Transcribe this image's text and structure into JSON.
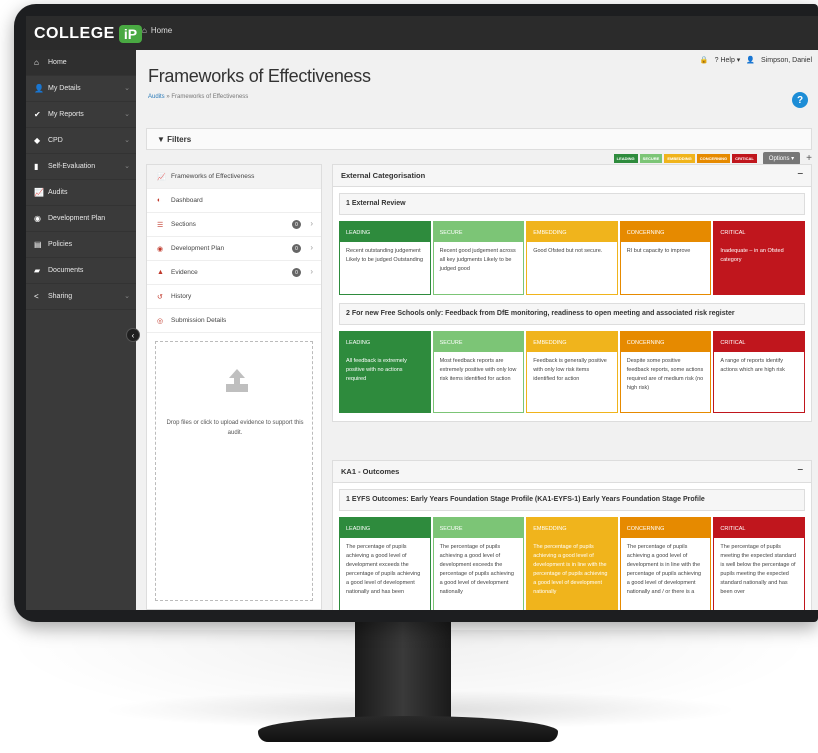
{
  "brand": {
    "name": "COLLEGE",
    "badge": "iP"
  },
  "topbar": {
    "home": "Home",
    "help": "Help",
    "user": "Simpson, Daniel"
  },
  "sidebar": {
    "items": [
      {
        "label": "Home",
        "icon": "home-icon"
      },
      {
        "label": "My Details",
        "icon": "user-icon"
      },
      {
        "label": "My Reports",
        "icon": "check-icon"
      },
      {
        "label": "CPD",
        "icon": "bolt-icon"
      },
      {
        "label": "Self-Evaluation",
        "icon": "book-icon"
      },
      {
        "label": "Audits",
        "icon": "chart-icon"
      },
      {
        "label": "Development Plan",
        "icon": "target-icon"
      },
      {
        "label": "Policies",
        "icon": "file-icon"
      },
      {
        "label": "Documents",
        "icon": "folder-icon"
      },
      {
        "label": "Sharing",
        "icon": "share-icon"
      }
    ]
  },
  "page": {
    "title": "Frameworks of Effectiveness",
    "breadcrumb_link": "Audits",
    "breadcrumb_current": "» Frameworks of Effectiveness",
    "help": "?"
  },
  "filters": {
    "label": "Filters",
    "options": "Options ▾",
    "plus": "+"
  },
  "legend": [
    {
      "label": "LEADING",
      "color": "#2e8b3d"
    },
    {
      "label": "SECURE",
      "color": "#7cc576"
    },
    {
      "label": "EMBEDDING",
      "color": "#f0b41c"
    },
    {
      "label": "CONCERNING",
      "color": "#e68a00"
    },
    {
      "label": "CRITICAL",
      "color": "#c0161d"
    }
  ],
  "leftnav": {
    "items": [
      {
        "label": "Frameworks of Effectiveness",
        "icon": "chart-icon"
      },
      {
        "label": "Dashboard",
        "icon": "dashboard-icon"
      },
      {
        "label": "Sections",
        "icon": "list-icon",
        "badge": "0"
      },
      {
        "label": "Development Plan",
        "icon": "target-icon",
        "badge": "0"
      },
      {
        "label": "Evidence",
        "icon": "warning-icon",
        "badge": "0"
      },
      {
        "label": "History",
        "icon": "history-icon"
      },
      {
        "label": "Submission Details",
        "icon": "record-icon"
      }
    ],
    "drop_text": "Drop files or click to upload evidence to support this audit."
  },
  "sections": [
    {
      "title": "External Categorisation",
      "subsections": [
        {
          "title": "1 External Review",
          "cards": [
            {
              "level": "LEADING",
              "text": "Recent outstanding judgement Likely to be judged Outstanding"
            },
            {
              "level": "SECURE",
              "text": "Recent good judgement across all key judgments Likely to be judged good"
            },
            {
              "level": "EMBEDDING",
              "text": "Good Ofsted but not secure."
            },
            {
              "level": "CONCERNING",
              "text": "RI but capacity to improve"
            },
            {
              "level": "CRITICAL",
              "text": "Inadequate – in an Ofsted category"
            }
          ]
        },
        {
          "title": "2 For new Free Schools only: Feedback from DfE monitoring, readiness to open meeting and associated risk register",
          "cards": [
            {
              "level": "LEADING",
              "text": "All feedback is extremely positive with no actions required"
            },
            {
              "level": "SECURE",
              "text": "Most feedback reports are extremely positive with only low risk items identified for action"
            },
            {
              "level": "EMBEDDING",
              "text": "Feedback is generally positive with only low risk items identified for action"
            },
            {
              "level": "CONCERNING",
              "text": "Despite some positive feedback reports, some actions required are of medium risk (no high risk)"
            },
            {
              "level": "CRITICAL",
              "text": "A range of reports identify actions which are high risk"
            }
          ]
        }
      ]
    },
    {
      "title": "KA1 - Outcomes",
      "subsections": [
        {
          "title": "1 EYFS Outcomes: Early Years Foundation Stage Profile (KA1-EYFS-1) Early Years Foundation Stage Profile",
          "cards": [
            {
              "level": "LEADING",
              "text": "The percentage of pupils achieving a good level of development exceeds the percentage of pupils achieving a good level of development nationally and has been"
            },
            {
              "level": "SECURE",
              "text": "The percentage of pupils achieving a good level of development exceeds the percentage of pupils achieving a good level of development nationally"
            },
            {
              "level": "EMBEDDING",
              "text": "The percentage of pupils achieving a good level of development is in line with the percentage of pupils achieving a good level of development nationally"
            },
            {
              "level": "CONCERNING",
              "text": "The percentage of pupils achieving a good level of development is in line with the percentage of pupils achieving a good level of development nationally and / or there is a"
            },
            {
              "level": "CRITICAL",
              "text": "The percentage of pupils meeting the expected standard is well below the percentage of pupils meeting the expected standard nationally and has been over"
            }
          ]
        }
      ]
    }
  ]
}
